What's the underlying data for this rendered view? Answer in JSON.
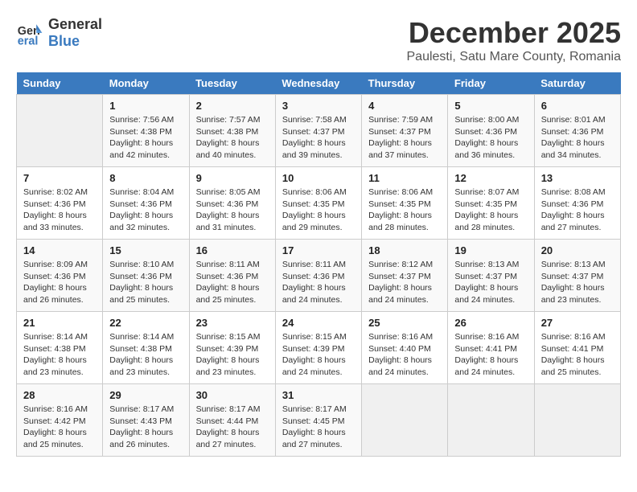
{
  "logo": {
    "line1": "General",
    "line2": "Blue"
  },
  "title": "December 2025",
  "location": "Paulesti, Satu Mare County, Romania",
  "days_of_week": [
    "Sunday",
    "Monday",
    "Tuesday",
    "Wednesday",
    "Thursday",
    "Friday",
    "Saturday"
  ],
  "weeks": [
    [
      {
        "day": "",
        "info": ""
      },
      {
        "day": "1",
        "info": "Sunrise: 7:56 AM\nSunset: 4:38 PM\nDaylight: 8 hours\nand 42 minutes."
      },
      {
        "day": "2",
        "info": "Sunrise: 7:57 AM\nSunset: 4:38 PM\nDaylight: 8 hours\nand 40 minutes."
      },
      {
        "day": "3",
        "info": "Sunrise: 7:58 AM\nSunset: 4:37 PM\nDaylight: 8 hours\nand 39 minutes."
      },
      {
        "day": "4",
        "info": "Sunrise: 7:59 AM\nSunset: 4:37 PM\nDaylight: 8 hours\nand 37 minutes."
      },
      {
        "day": "5",
        "info": "Sunrise: 8:00 AM\nSunset: 4:36 PM\nDaylight: 8 hours\nand 36 minutes."
      },
      {
        "day": "6",
        "info": "Sunrise: 8:01 AM\nSunset: 4:36 PM\nDaylight: 8 hours\nand 34 minutes."
      }
    ],
    [
      {
        "day": "7",
        "info": "Sunrise: 8:02 AM\nSunset: 4:36 PM\nDaylight: 8 hours\nand 33 minutes."
      },
      {
        "day": "8",
        "info": "Sunrise: 8:04 AM\nSunset: 4:36 PM\nDaylight: 8 hours\nand 32 minutes."
      },
      {
        "day": "9",
        "info": "Sunrise: 8:05 AM\nSunset: 4:36 PM\nDaylight: 8 hours\nand 31 minutes."
      },
      {
        "day": "10",
        "info": "Sunrise: 8:06 AM\nSunset: 4:35 PM\nDaylight: 8 hours\nand 29 minutes."
      },
      {
        "day": "11",
        "info": "Sunrise: 8:06 AM\nSunset: 4:35 PM\nDaylight: 8 hours\nand 28 minutes."
      },
      {
        "day": "12",
        "info": "Sunrise: 8:07 AM\nSunset: 4:35 PM\nDaylight: 8 hours\nand 28 minutes."
      },
      {
        "day": "13",
        "info": "Sunrise: 8:08 AM\nSunset: 4:36 PM\nDaylight: 8 hours\nand 27 minutes."
      }
    ],
    [
      {
        "day": "14",
        "info": "Sunrise: 8:09 AM\nSunset: 4:36 PM\nDaylight: 8 hours\nand 26 minutes."
      },
      {
        "day": "15",
        "info": "Sunrise: 8:10 AM\nSunset: 4:36 PM\nDaylight: 8 hours\nand 25 minutes."
      },
      {
        "day": "16",
        "info": "Sunrise: 8:11 AM\nSunset: 4:36 PM\nDaylight: 8 hours\nand 25 minutes."
      },
      {
        "day": "17",
        "info": "Sunrise: 8:11 AM\nSunset: 4:36 PM\nDaylight: 8 hours\nand 24 minutes."
      },
      {
        "day": "18",
        "info": "Sunrise: 8:12 AM\nSunset: 4:37 PM\nDaylight: 8 hours\nand 24 minutes."
      },
      {
        "day": "19",
        "info": "Sunrise: 8:13 AM\nSunset: 4:37 PM\nDaylight: 8 hours\nand 24 minutes."
      },
      {
        "day": "20",
        "info": "Sunrise: 8:13 AM\nSunset: 4:37 PM\nDaylight: 8 hours\nand 23 minutes."
      }
    ],
    [
      {
        "day": "21",
        "info": "Sunrise: 8:14 AM\nSunset: 4:38 PM\nDaylight: 8 hours\nand 23 minutes."
      },
      {
        "day": "22",
        "info": "Sunrise: 8:14 AM\nSunset: 4:38 PM\nDaylight: 8 hours\nand 23 minutes."
      },
      {
        "day": "23",
        "info": "Sunrise: 8:15 AM\nSunset: 4:39 PM\nDaylight: 8 hours\nand 23 minutes."
      },
      {
        "day": "24",
        "info": "Sunrise: 8:15 AM\nSunset: 4:39 PM\nDaylight: 8 hours\nand 24 minutes."
      },
      {
        "day": "25",
        "info": "Sunrise: 8:16 AM\nSunset: 4:40 PM\nDaylight: 8 hours\nand 24 minutes."
      },
      {
        "day": "26",
        "info": "Sunrise: 8:16 AM\nSunset: 4:41 PM\nDaylight: 8 hours\nand 24 minutes."
      },
      {
        "day": "27",
        "info": "Sunrise: 8:16 AM\nSunset: 4:41 PM\nDaylight: 8 hours\nand 25 minutes."
      }
    ],
    [
      {
        "day": "28",
        "info": "Sunrise: 8:16 AM\nSunset: 4:42 PM\nDaylight: 8 hours\nand 25 minutes."
      },
      {
        "day": "29",
        "info": "Sunrise: 8:17 AM\nSunset: 4:43 PM\nDaylight: 8 hours\nand 26 minutes."
      },
      {
        "day": "30",
        "info": "Sunrise: 8:17 AM\nSunset: 4:44 PM\nDaylight: 8 hours\nand 27 minutes."
      },
      {
        "day": "31",
        "info": "Sunrise: 8:17 AM\nSunset: 4:45 PM\nDaylight: 8 hours\nand 27 minutes."
      },
      {
        "day": "",
        "info": ""
      },
      {
        "day": "",
        "info": ""
      },
      {
        "day": "",
        "info": ""
      }
    ]
  ]
}
